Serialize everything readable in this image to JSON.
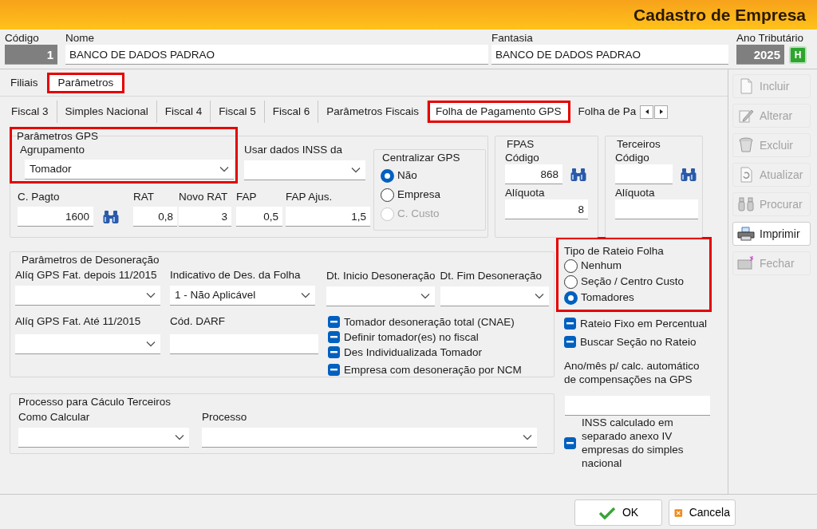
{
  "window": {
    "title": "Cadastro de Empresa"
  },
  "header_fields": [
    {
      "label": "Código",
      "value": "1",
      "kind": "readonly"
    },
    {
      "label": "Nome",
      "value": "BANCO DE DADOS PADRAO",
      "kind": "text"
    },
    {
      "label": "Fantasia",
      "value": "BANCO DE DADOS PADRAO",
      "kind": "text"
    },
    {
      "label": "Ano Tributário",
      "value": "2025",
      "kind": "readonly"
    }
  ],
  "help_button": "H",
  "outer_tabs": [
    {
      "label": "Filiais",
      "selected": false,
      "highlighted": false
    },
    {
      "label": "Parâmetros",
      "selected": true,
      "highlighted": true
    }
  ],
  "inner_tabs": [
    {
      "label": "Fiscal 3",
      "selected": false,
      "highlighted": false
    },
    {
      "label": "Simples Nacional",
      "selected": false,
      "highlighted": false
    },
    {
      "label": "Fiscal 4",
      "selected": false,
      "highlighted": false
    },
    {
      "label": "Fiscal 5",
      "selected": false,
      "highlighted": false
    },
    {
      "label": "Fiscal 6",
      "selected": false,
      "highlighted": false
    },
    {
      "label": "Parâmetros Fiscais",
      "selected": false,
      "highlighted": false
    },
    {
      "label": "Folha de Pagamento GPS",
      "selected": true,
      "highlighted": true
    },
    {
      "label": "Folha de Pa",
      "selected": false,
      "highlighted": false
    }
  ],
  "gps_group": {
    "title": "Parâmetros GPS",
    "highlighted": true,
    "agrupamento": {
      "label": "Agrupamento",
      "value": "Tomador"
    },
    "usar_dados_inss": {
      "label": "Usar dados INSS da"
    },
    "values": [
      {
        "label": "C. Pagto",
        "value": "1600",
        "kind": "lookup"
      },
      {
        "label": "RAT",
        "value": "0,8",
        "kind": "text"
      },
      {
        "label": "Novo RAT",
        "value": "3",
        "kind": "text"
      },
      {
        "label": "FAP",
        "value": "0,5",
        "kind": "text"
      },
      {
        "label": "FAP Ajus.",
        "value": "1,5",
        "kind": "text"
      }
    ]
  },
  "centralizar_gps": {
    "title": "Centralizar GPS",
    "options": [
      {
        "label": "Não",
        "selected": true,
        "disabled": false
      },
      {
        "label": "Empresa",
        "selected": false,
        "disabled": false
      },
      {
        "label": "C. Custo",
        "selected": false,
        "disabled": true
      }
    ]
  },
  "fpas": {
    "title": "FPAS",
    "codigo": {
      "label": "Código",
      "value": "868"
    },
    "aliquota": {
      "label": "Alíquota",
      "value": "8"
    }
  },
  "terceiros": {
    "title": "Terceiros",
    "codigo": {
      "label": "Código"
    },
    "aliquota": {
      "label": "Alíquota"
    }
  },
  "desoneracao": {
    "title": "Parâmetros de Desoneração",
    "fields": [
      {
        "label": "Alíq GPS Fat. depois 11/2015",
        "kind": "select"
      },
      {
        "label": "Indicativo de Des. da Folha",
        "kind": "select",
        "value": "1 - Não Aplicável"
      },
      {
        "label": "Dt. Inicio Desoneração",
        "kind": "select"
      },
      {
        "label": "Dt. Fim Desoneração",
        "kind": "select"
      },
      {
        "label": "Alíq GPS Fat. Até 11/2015",
        "kind": "select"
      },
      {
        "label": "Cód. DARF",
        "kind": "text"
      }
    ],
    "checkboxes": [
      {
        "label": "Tomador desoneração total (CNAE)",
        "indeterminate": true
      },
      {
        "label": "Definir tomador(es) no fiscal",
        "indeterminate": true
      },
      {
        "label": "Des Individualizada Tomador",
        "indeterminate": true
      },
      {
        "label": "Empresa com desoneração por NCM",
        "indeterminate": true
      }
    ]
  },
  "processo_group": {
    "title": "Processo para Cáculo Terceiros",
    "fields": [
      {
        "label": "Como Calcular",
        "kind": "select"
      },
      {
        "label": "Processo",
        "kind": "select"
      }
    ]
  },
  "rateio": {
    "title": "Tipo de Rateio Folha",
    "highlighted": true,
    "options": [
      {
        "label": "Nenhum",
        "selected": false
      },
      {
        "label": "Seção / Centro Custo",
        "selected": false
      },
      {
        "label": "Tomadores",
        "selected": true
      }
    ]
  },
  "rateio_checkboxes": [
    {
      "label": "Rateio Fixo em Percentual",
      "indeterminate": true
    },
    {
      "label": "Buscar Seção no Rateio",
      "indeterminate": true
    }
  ],
  "compensacao": {
    "label": "Ano/mês p/ calc. automático de compensações na GPS"
  },
  "inss_anexo": {
    "label": "INSS calculado em separado anexo IV empresas do simples nacional",
    "indeterminate": true
  },
  "toolbar": [
    {
      "label": "Incluir",
      "kind": "page",
      "disabled": true
    },
    {
      "label": "Alterar",
      "kind": "pencil",
      "disabled": true
    },
    {
      "label": "Excluir",
      "kind": "trash",
      "disabled": true
    },
    {
      "label": "Atualizar",
      "kind": "refresh",
      "disabled": true
    },
    {
      "label": "Procurar",
      "kind": "binoculars",
      "disabled": true
    },
    {
      "label": "Imprimir",
      "kind": "printer",
      "disabled": false
    },
    {
      "label": "Fechar",
      "kind": "exit",
      "disabled": true
    }
  ],
  "dialog_buttons": [
    {
      "label": "OK",
      "kind": "ok"
    },
    {
      "label": "Cancela",
      "kind": "cancel"
    }
  ]
}
